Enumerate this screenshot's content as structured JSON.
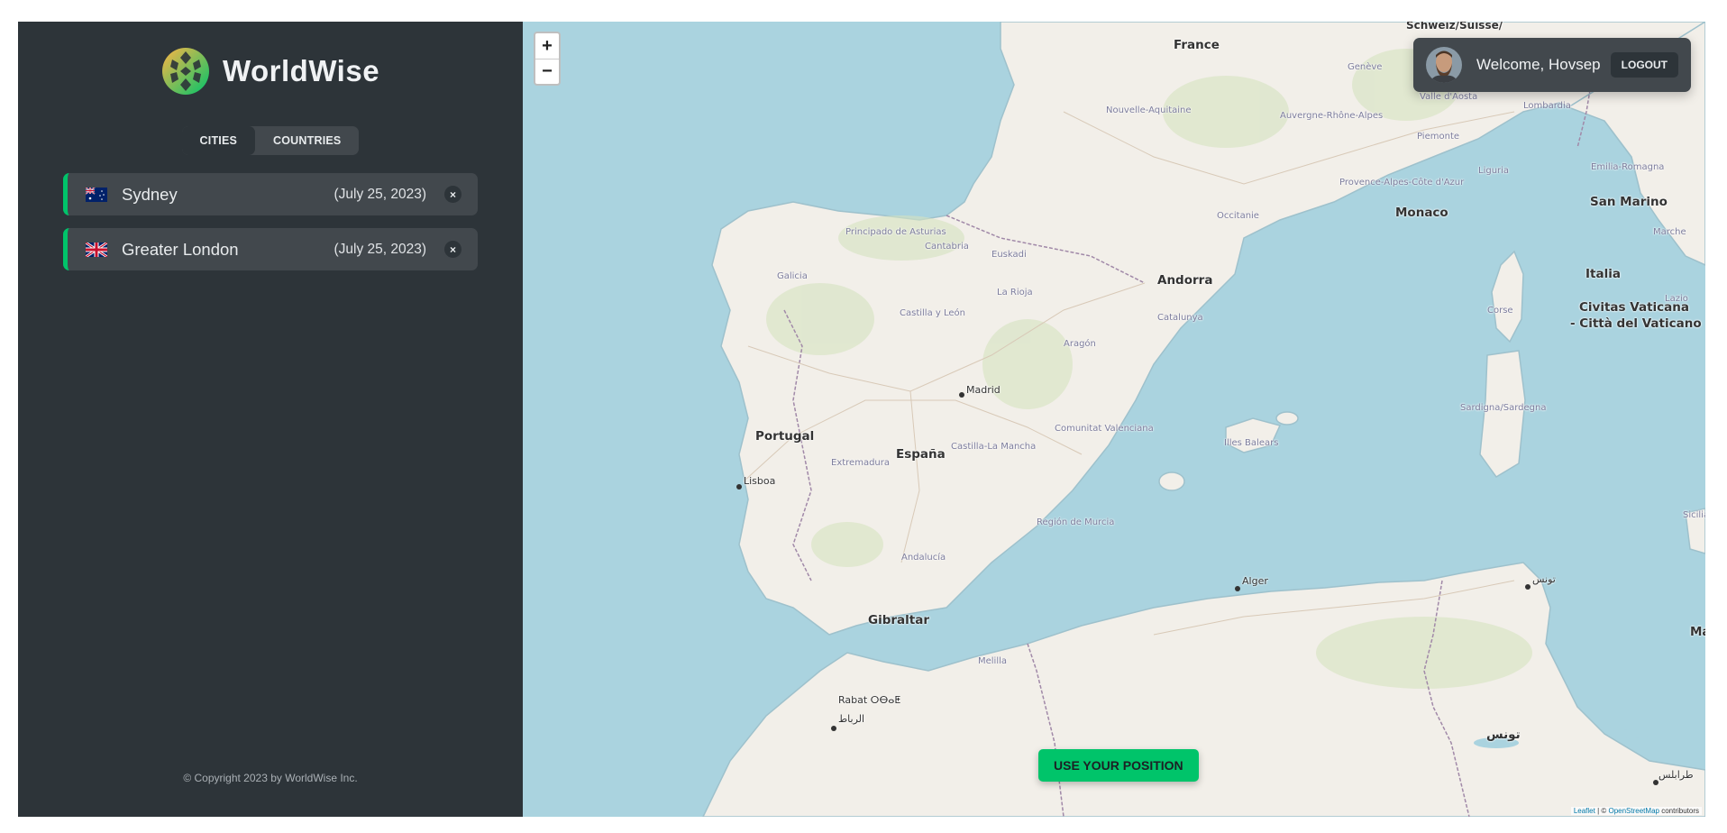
{
  "app": {
    "name": "WorldWise",
    "copyright": "© Copyright 2023 by WorldWise Inc."
  },
  "nav": {
    "tabs": [
      {
        "label": "CITIES",
        "active": true
      },
      {
        "label": "COUNTRIES",
        "active": false
      }
    ]
  },
  "cities": [
    {
      "name": "Sydney",
      "date": "(July 25, 2023)",
      "flag": "australia-flag",
      "delete": "×"
    },
    {
      "name": "Greater London",
      "date": "(July 25, 2023)",
      "flag": "uk-flag",
      "delete": "×"
    }
  ],
  "map": {
    "zoom_in": "+",
    "zoom_out": "−",
    "use_position": "USE YOUR POSITION",
    "attribution": {
      "leaflet": "Leaflet",
      "sep": " | © ",
      "osm": "OpenStreetMap",
      "contributors": " contributors"
    },
    "labels": {
      "france": "France",
      "schweiz": "Schweiz/Suisse/",
      "andorra": "Andorra",
      "monaco": "Monaco",
      "san_marino": "San Marino",
      "italia": "Italia",
      "vaticano_1": "Civitas Vaticana",
      "vaticano_2": "- Città del Vaticano",
      "portugal": "Portugal",
      "espana": "España",
      "madrid": "Madrid",
      "lisboa": "Lisboa",
      "gibraltar": "Gibraltar",
      "alger": "Alger",
      "rabat": "Rabat ⵔⴱⴰⵟ",
      "rabat_ar": "الرباط",
      "tunis": "تونس",
      "tunisie": "تونس",
      "tripoli": "طرابلس",
      "melilla": "Melilla",
      "nouvelle_aquitaine": "Nouvelle-Aquitaine",
      "occitanie": "Occitanie",
      "auvergne": "Auvergne-Rhône-Alpes",
      "provence": "Provence-Alpes-Côte d'Azur",
      "galicia": "Galicia",
      "castilla_leon": "Castilla y León",
      "aragon": "Aragón",
      "catalunya": "Catalunya",
      "extremadura": "Extremadura",
      "castilla_mancha": "Castilla-La Mancha",
      "valenciana": "Comunitat Valenciana",
      "murcia": "Región de Murcia",
      "andalucia": "Andalucía",
      "illes_balears": "Illes Balears",
      "sardegna": "Sardigna/Sardegna",
      "corse": "Corse",
      "lombardia": "Lombardia",
      "piemonte": "Piemonte",
      "liguria": "Liguria",
      "emilia": "Emilia-Romagna",
      "marche": "Marche",
      "lazio": "Lazio",
      "principado": "Principado de Asturias",
      "cantabria": "Cantabria",
      "euskadi": "Euskadi",
      "la_rioja": "La Rioja",
      "sicilia": "Sicilia",
      "malta_cut": "Ma",
      "geneve": "Genève",
      "aosta": "Valle d'Aosta"
    }
  },
  "user": {
    "welcome": "Welcome, Hovsep",
    "logout": "LOGOUT"
  },
  "colors": {
    "sidebar_bg": "#2d3439",
    "item_bg": "#42484d",
    "accent_green": "#00c46a",
    "sea": "#aad3df",
    "land": "#f2efe9"
  }
}
